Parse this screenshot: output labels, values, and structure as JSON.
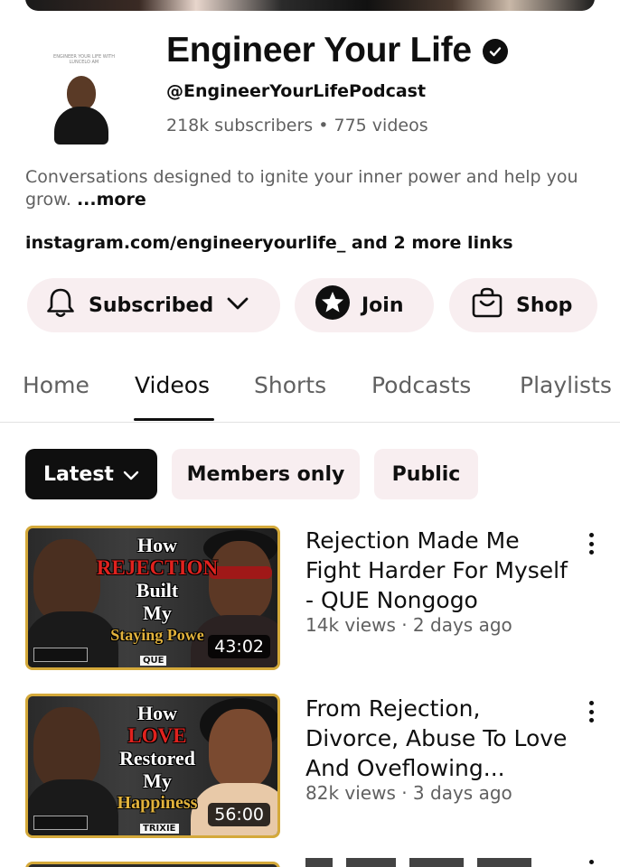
{
  "channel": {
    "name": "Engineer Your Life",
    "handle": "@EngineerYourLifePodcast",
    "stats": "218k subscribers • 775 videos",
    "avatar_text": "ENGINEER YOUR LIFE WITH LUNCELO AM",
    "description": "Conversations designed to ignite your inner power and help you grow. ",
    "more_label": "...more",
    "links": "instagram.com/engineeryourlife_ and 2 more links"
  },
  "actions": {
    "subscribed_label": "Subscribed",
    "join_label": "Join",
    "shop_label": "Shop"
  },
  "tabs": [
    {
      "label": "Home"
    },
    {
      "label": "Videos"
    },
    {
      "label": "Shorts"
    },
    {
      "label": "Podcasts"
    },
    {
      "label": "Playlists"
    }
  ],
  "filters": {
    "latest": "Latest",
    "members": "Members only",
    "public": "Public"
  },
  "videos": [
    {
      "title": "Rejection Made Me Fight Harder For Myself - QUE Nongogo",
      "meta": "14k views · 2 days ago",
      "duration": "43:02",
      "thumb_line1": "How",
      "thumb_line2": "REJECTION",
      "thumb_line3": "Built",
      "thumb_line4": "My",
      "thumb_line5": "Staying Powe",
      "thumb_tag": "QUE"
    },
    {
      "title": "From Rejection, Divorce, Abuse To Love And Oveflowing...",
      "meta": "82k views · 3 days ago",
      "duration": "56:00",
      "thumb_line1": "How",
      "thumb_line2": "LOVE",
      "thumb_line3": "Restored",
      "thumb_line4": "My",
      "thumb_line5": "Happiness",
      "thumb_tag": "TRIXIE"
    }
  ],
  "colors": {
    "accent_gold": "#d4a93a",
    "chip_bg": "#f8eef0",
    "text_secondary": "#606060"
  }
}
